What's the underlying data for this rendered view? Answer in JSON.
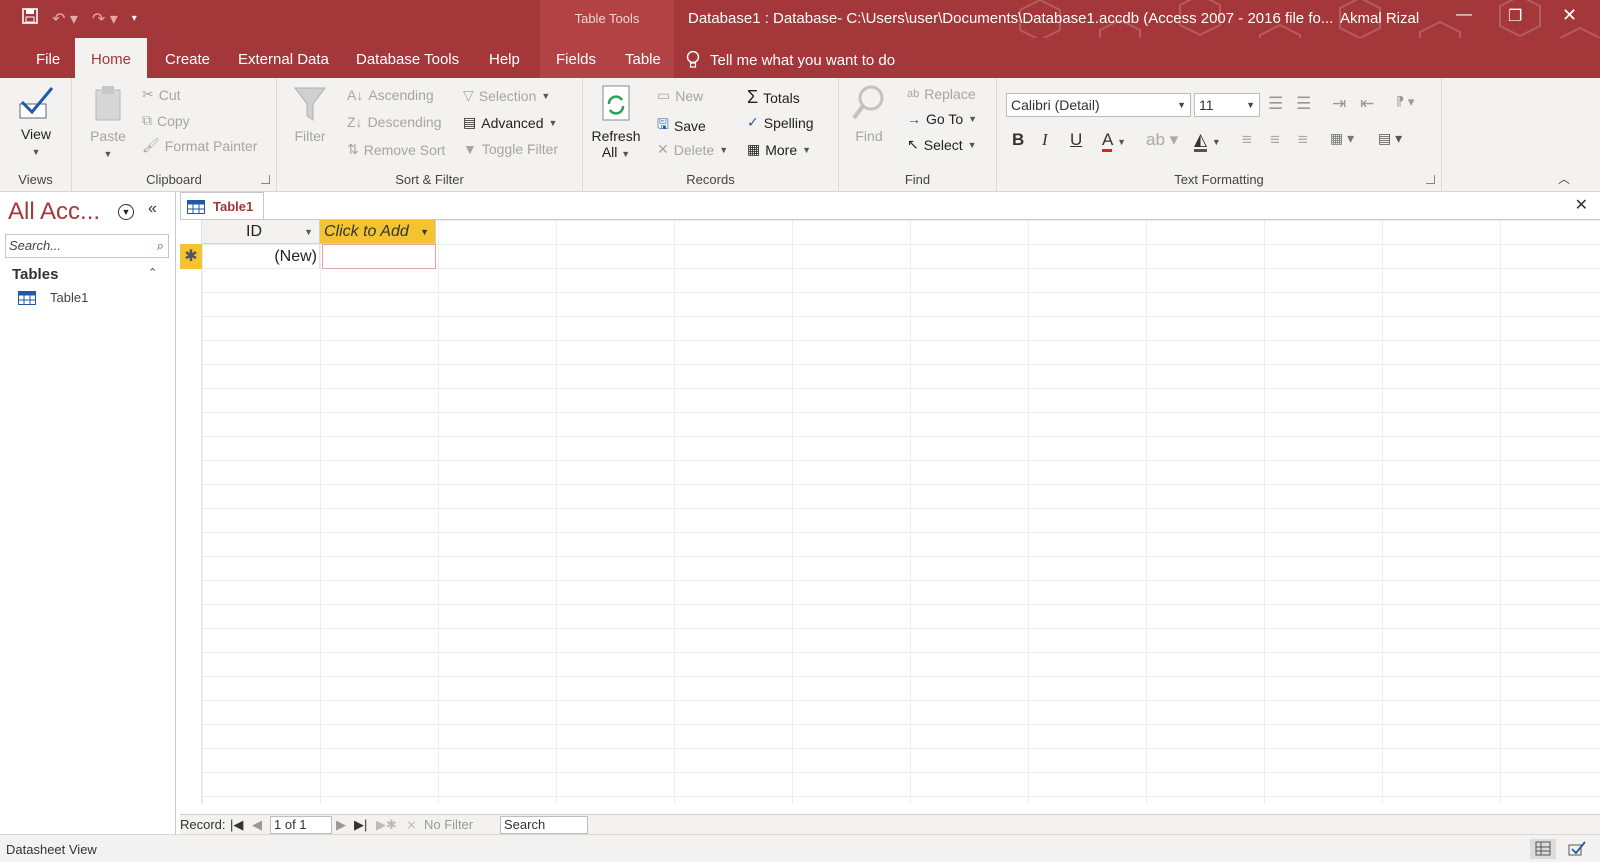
{
  "title_bar": {
    "context_tab": "Table Tools",
    "window_title": "Database1 : Database- C:\\Users\\user\\Documents\\Database1.accdb (Access 2007 - 2016 file fo...",
    "user": "Akmal Rizal",
    "accent_color": "#a4373a"
  },
  "tabs": [
    "File",
    "Home",
    "Create",
    "External Data",
    "Database Tools",
    "Help",
    "Fields",
    "Table"
  ],
  "active_tab": "Home",
  "tell_me": "Tell me what you want to do",
  "ribbon": {
    "views": {
      "label": "Views",
      "view": "View"
    },
    "clipboard": {
      "label": "Clipboard",
      "paste": "Paste",
      "cut": "Cut",
      "copy": "Copy",
      "format_painter": "Format Painter"
    },
    "sort_filter": {
      "label": "Sort & Filter",
      "filter": "Filter",
      "ascending": "Ascending",
      "descending": "Descending",
      "remove_sort": "Remove Sort",
      "selection": "Selection",
      "advanced": "Advanced",
      "toggle_filter": "Toggle Filter"
    },
    "records": {
      "label": "Records",
      "refresh": "Refresh",
      "refresh_all": "All",
      "new": "New",
      "save": "Save",
      "delete": "Delete",
      "totals": "Totals",
      "spelling": "Spelling",
      "more": "More"
    },
    "find": {
      "label": "Find",
      "find": "Find",
      "replace": "Replace",
      "goto": "Go To",
      "select": "Select"
    },
    "text_formatting": {
      "label": "Text Formatting",
      "font": "Calibri (Detail)",
      "size": "11",
      "bold": "B",
      "italic": "I",
      "underline": "U"
    }
  },
  "nav_pane": {
    "title": "All Acc...",
    "search_placeholder": "Search...",
    "section": "Tables",
    "items": [
      "Table1"
    ]
  },
  "document": {
    "tab": "Table1",
    "columns": [
      "ID",
      "Click to Add"
    ],
    "new_row": "(New)"
  },
  "record_nav": {
    "label": "Record:",
    "position": "1 of 1",
    "filter": "No Filter",
    "search": "Search"
  },
  "status_bar": {
    "text": "Datasheet View"
  }
}
